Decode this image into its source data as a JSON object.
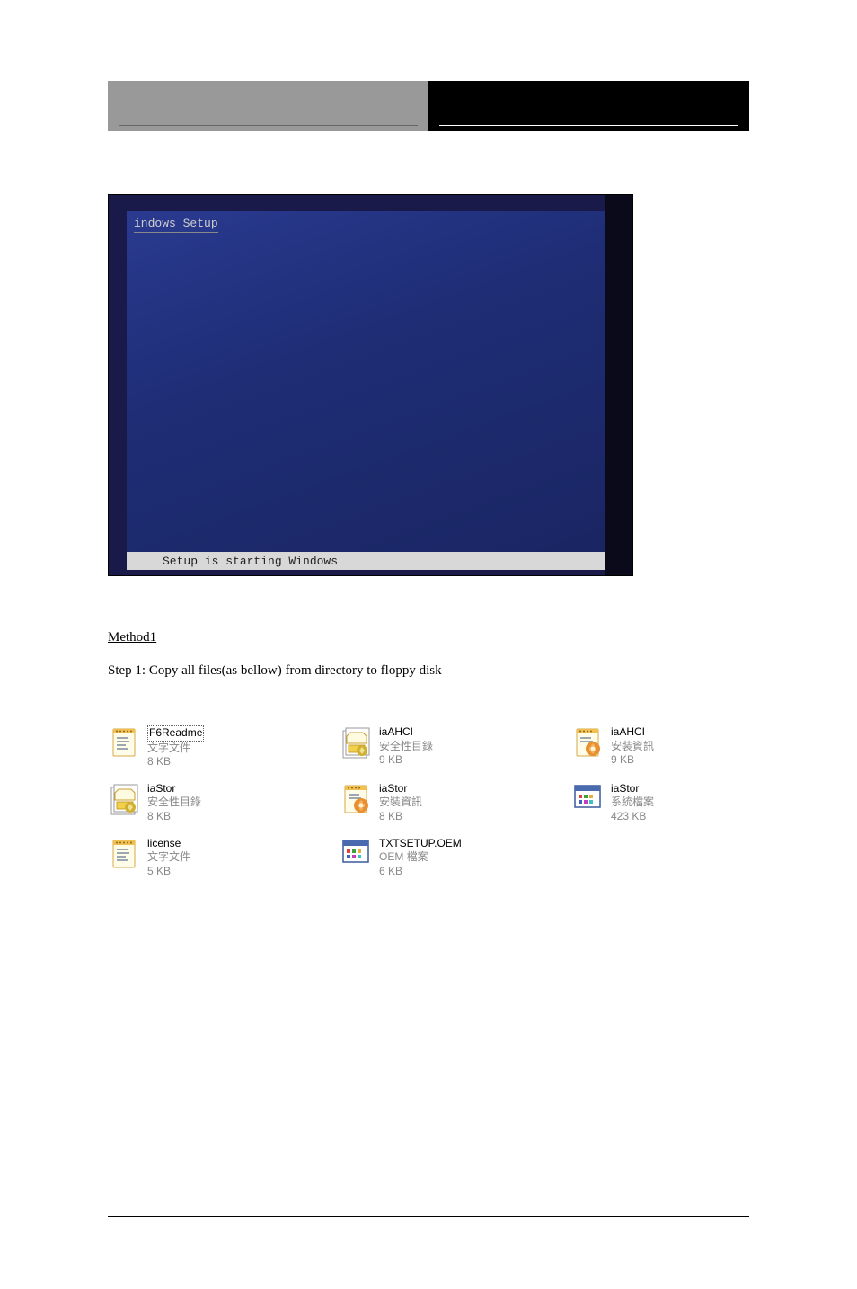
{
  "header": {
    "left_text": " ",
    "right_text": " "
  },
  "screenshot": {
    "title": "indows Setup",
    "status": "Setup is starting Windows"
  },
  "section_label": "Method1",
  "instruction": "Step 1: Copy all files(as bellow) from directory to floppy disk",
  "files": [
    {
      "name": "F6Readme",
      "type": "文字文件",
      "size": "8 KB",
      "icon": "notepad",
      "highlighted": true
    },
    {
      "name": "iaAHCI",
      "type": "安全性目錄",
      "size": "9 KB",
      "icon": "security"
    },
    {
      "name": "iaAHCI",
      "type": "安裝資訊",
      "size": "9 KB",
      "icon": "inf"
    },
    {
      "name": "iaStor",
      "type": "安全性目錄",
      "size": "8 KB",
      "icon": "security"
    },
    {
      "name": "iaStor",
      "type": "安裝資訊",
      "size": "8 KB",
      "icon": "inf"
    },
    {
      "name": "iaStor",
      "type": "系統檔案",
      "size": "423 KB",
      "icon": "sys"
    },
    {
      "name": "license",
      "type": "文字文件",
      "size": "5 KB",
      "icon": "notepad"
    },
    {
      "name": "TXTSETUP.OEM",
      "type": "OEM 檔案",
      "size": "6 KB",
      "icon": "oem"
    }
  ],
  "icon_svg": {
    "notepad": "notepad",
    "security": "security",
    "inf": "inf",
    "oem": "oem",
    "sys": "sys"
  }
}
